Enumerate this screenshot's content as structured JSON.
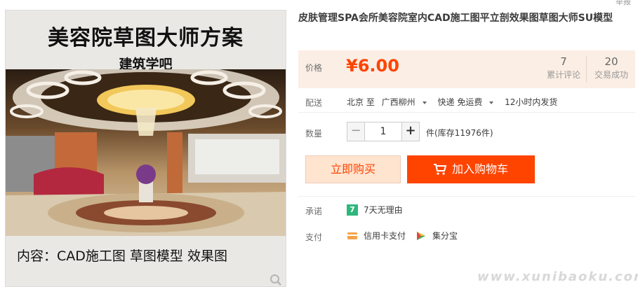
{
  "gallery": {
    "title": "美容院草图大师方案",
    "subtitle": "建筑学吧",
    "content_line": "内容：CAD施工图   草图模型   效果图"
  },
  "product": {
    "title": "皮肤管理SPA会所美容院室内CAD施工图平立剖效果图草图大师SU模型",
    "top_hint": "举报"
  },
  "price": {
    "label": "价格",
    "value": "¥6.00",
    "reviews_count": "7",
    "reviews_label": "累计评论",
    "sales_count": "20",
    "sales_label": "交易成功"
  },
  "shipping": {
    "label": "配送",
    "from": "北京 至",
    "to": "广西柳州",
    "method": "快递 免运费",
    "dispatch": "12小时内发货"
  },
  "quantity": {
    "label": "数量",
    "minus": "−",
    "value": "1",
    "plus": "+",
    "stock": "件(库存11976件)"
  },
  "actions": {
    "buy_now": "立即购买",
    "add_to_cart": "加入购物车"
  },
  "promise": {
    "label": "承诺",
    "badge": "7",
    "text": "7天无理由"
  },
  "payment": {
    "label": "支付",
    "credit": "信用卡支付",
    "jifen": "集分宝"
  },
  "watermark": "www.xunibaoku.com",
  "colors": {
    "accent": "#ff4400",
    "price_bg": "#fbeee4",
    "badge_green": "#2db87b"
  }
}
